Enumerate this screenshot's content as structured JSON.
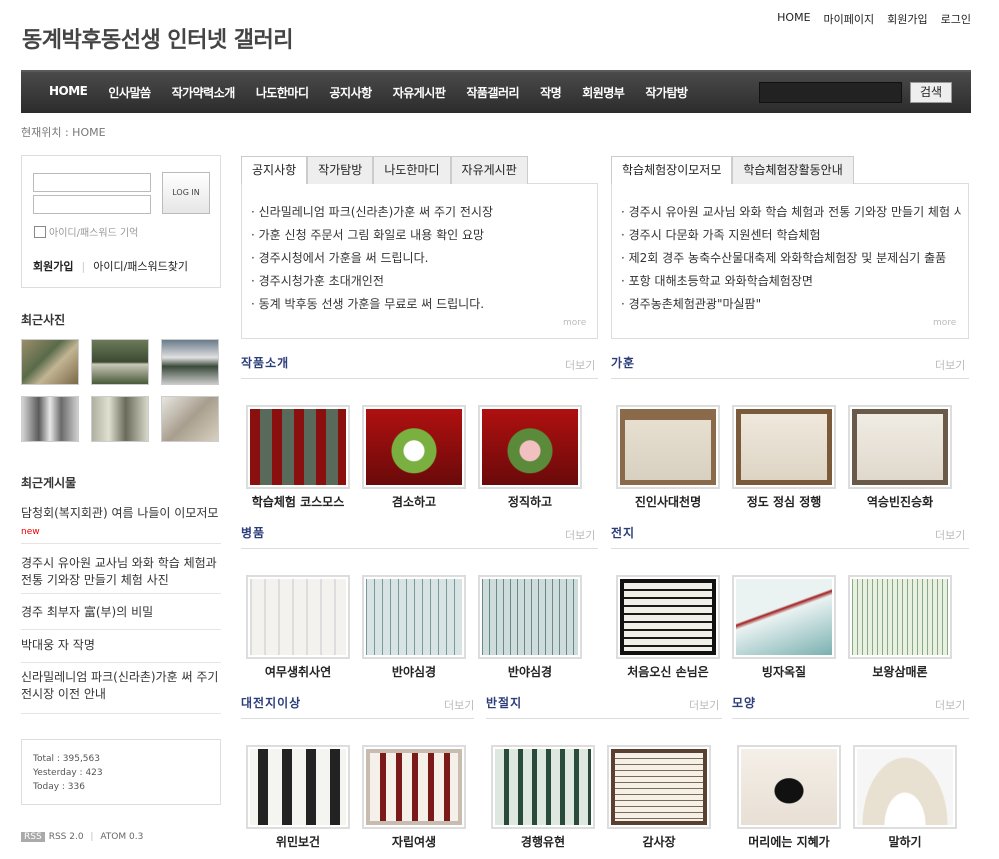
{
  "site": {
    "title": "동계박후동선생 인터넷 갤러리"
  },
  "top_links": [
    "HOME",
    "마이페이지",
    "회원가입",
    "로그인"
  ],
  "nav": {
    "items": [
      "HOME",
      "인사말씀",
      "작가약력소개",
      "나도한마디",
      "공지사항",
      "자유게시판",
      "작품갤러리",
      "작명",
      "회원명부",
      "작가탐방"
    ],
    "search_button": "검색"
  },
  "breadcrumb": "현재위치 : HOME",
  "login": {
    "button": "LOG IN",
    "remember": "아이디/패스워드 기억",
    "join": "회원가입",
    "find": "아이디/패스워드찾기"
  },
  "recent_photos": {
    "title": "최근사진"
  },
  "recent_posts": {
    "title": "최근게시물",
    "items": [
      {
        "text": "담청회(복지회관) 여름 나들이 이모저모",
        "badge": "new"
      },
      {
        "text": "경주시 유아원 교사님 와화 학습 체험과 전통 기와장 만들기 체험 사진",
        "badge": ""
      },
      {
        "text": "경주 최부자 富(부)의 비밀",
        "badge": ""
      },
      {
        "text": "박대웅 자 작명",
        "badge": ""
      },
      {
        "text": "신라밀레니엄 파크(신라촌)가훈 써 주기 전시장 이전 안내",
        "badge": ""
      }
    ]
  },
  "stats": {
    "total": "Total : 395,563",
    "yesterday": "Yesterday : 423",
    "today": "Today : 336"
  },
  "feeds": {
    "rss_badge": "RSS",
    "rss": "RSS 2.0",
    "sep": "|",
    "atom": "ATOM 0.3"
  },
  "board_left": {
    "tabs": [
      "공지사항",
      "작가탐방",
      "나도한마디",
      "자유게시판"
    ],
    "items": [
      "· 신라밀레니엄 파크(신라촌)가훈 써 주기 전시장",
      "· 가훈 신청 주문서 그림 화일로 내용 확인 요망",
      "· 경주시청에서 가훈을 써 드립니다.",
      "· 경주시청가훈 초대개인전",
      "· 동계 박후동 선생 가훈을 무료로 써 드립니다."
    ],
    "more": "more"
  },
  "board_right": {
    "tabs": [
      "학습체험장이모저모",
      "학습체험장활동안내"
    ],
    "items": [
      "· 경주시 유아원 교사님 와화 학습 체험과 전통 기와장 만들기 체험 사진",
      "· 경주시 다문화 가족 지원센터 학습체험",
      "· 제2회 경주 농축수산물대축제 와화학습체험장 및 분제심기 출품",
      "· 포항 대해초등학교 와화학습체험장면",
      "· 경주농촌체험관광\"마실팜\""
    ],
    "more": "more"
  },
  "galleries": [
    {
      "title": "작품소개",
      "more": "더보기",
      "captions": [
        "학습체험 코스모스",
        "겸소하고",
        "정직하고"
      ]
    },
    {
      "title": "가훈",
      "more": "더보기",
      "captions": [
        "진인사대천명",
        "정도 정심 정행",
        "역승빈진승화"
      ]
    },
    {
      "title": "병품",
      "more": "더보기",
      "captions": [
        "여무생취사연",
        "반야심경",
        "반야심경"
      ]
    },
    {
      "title": "전지",
      "more": "더보기",
      "captions": [
        "처음오신 손님은",
        "빙자옥질",
        "보왕삼매론"
      ]
    },
    {
      "title": "대전지이상",
      "more": "더보기",
      "captions": [
        "위민보건",
        "자립여생"
      ]
    },
    {
      "title": "반절지",
      "more": "더보기",
      "captions": [
        "경행유현",
        "감사장"
      ]
    },
    {
      "title": "모양",
      "more": "더보기",
      "captions": [
        "머리에는 지혜가",
        "말하기"
      ]
    }
  ],
  "colors": {
    "nav_bg": "#333333",
    "accent_heading": "#2c3e7a",
    "new_badge": "#e00000"
  }
}
